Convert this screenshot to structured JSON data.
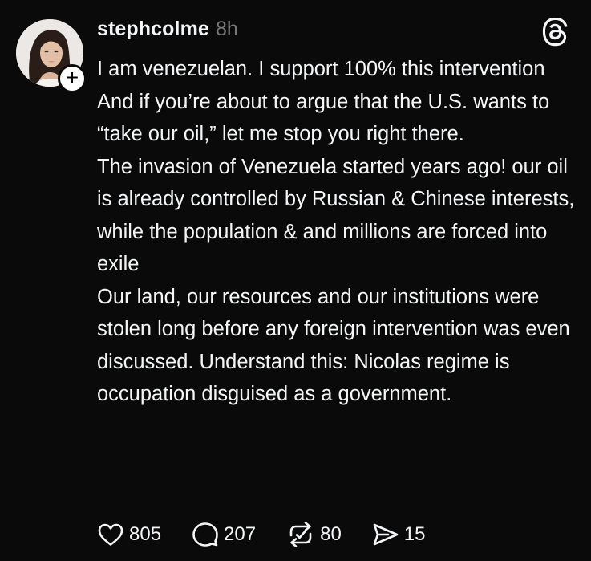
{
  "post": {
    "username": "stephcolme",
    "time": "8h",
    "paragraphs": [
      "I am venezuelan. I support 100% this intervention",
      "And if you’re about to argue that the U.S. wants to “take our oil,” let me stop you right there.",
      "The invasion of Venezuela started years ago! our oil is already controlled by Russian & Chinese interests, while the population & and millions are forced into exile",
      "Our land, our resources and our institutions were stolen long before any foreign intervention was even discussed. Understand this: Nicolas regime is occupation disguised as a government."
    ],
    "actions": {
      "likes": "805",
      "replies": "207",
      "reposts": "80",
      "shares": "15"
    }
  },
  "icons": {
    "follow": "plus-icon",
    "app": "threads-logo-icon",
    "like": "heart-icon",
    "reply": "comment-icon",
    "repost": "repost-icon",
    "share": "send-icon"
  },
  "colors": {
    "background": "#0a0a0a",
    "text": "#f3f5f7",
    "muted": "#777777"
  }
}
